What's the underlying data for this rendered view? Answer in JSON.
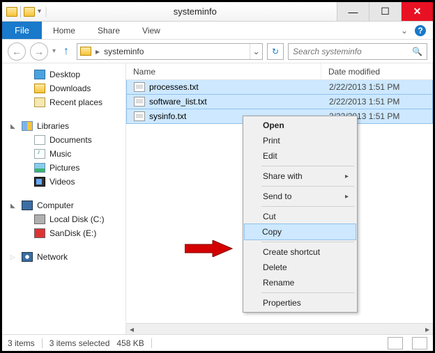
{
  "title": "systeminfo",
  "ribbon": {
    "file": "File",
    "tabs": [
      "Home",
      "Share",
      "View"
    ]
  },
  "nav": {
    "path_segment": "systeminfo",
    "search_placeholder": "Search systeminfo"
  },
  "navpane": {
    "quick": [
      {
        "label": "Desktop",
        "icon": "desktop"
      },
      {
        "label": "Downloads",
        "icon": "folder"
      },
      {
        "label": "Recent places",
        "icon": "recent"
      }
    ],
    "libraries_head": "Libraries",
    "libraries": [
      {
        "label": "Documents",
        "icon": "doc"
      },
      {
        "label": "Music",
        "icon": "music"
      },
      {
        "label": "Pictures",
        "icon": "pic"
      },
      {
        "label": "Videos",
        "icon": "vid"
      }
    ],
    "computer_head": "Computer",
    "computer": [
      {
        "label": "Local Disk (C:)",
        "icon": "hdd"
      },
      {
        "label": "SanDisk (E:)",
        "icon": "hdd red"
      }
    ],
    "network_head": "Network"
  },
  "columns": {
    "name": "Name",
    "date": "Date modified"
  },
  "files": [
    {
      "name": "processes.txt",
      "date": "2/22/2013 1:51 PM"
    },
    {
      "name": "software_list.txt",
      "date": "2/22/2013 1:51 PM"
    },
    {
      "name": "sysinfo.txt",
      "date": "2/22/2013 1:51 PM"
    }
  ],
  "context_menu": {
    "open": "Open",
    "print": "Print",
    "edit": "Edit",
    "share": "Share with",
    "sendto": "Send to",
    "cut": "Cut",
    "copy": "Copy",
    "shortcut": "Create shortcut",
    "delete": "Delete",
    "rename": "Rename",
    "properties": "Properties"
  },
  "status": {
    "count": "3 items",
    "selected": "3 items selected",
    "size": "458 KB"
  }
}
